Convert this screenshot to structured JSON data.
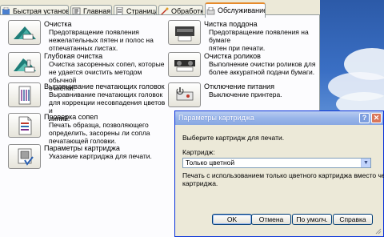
{
  "tabs": [
    {
      "label": "Быстрая установка",
      "icon": "quick-setup-icon"
    },
    {
      "label": "Главная",
      "icon": "main-icon"
    },
    {
      "label": "Страница",
      "icon": "page-icon"
    },
    {
      "label": "Обработка",
      "icon": "effects-icon"
    },
    {
      "label": "Обслуживание",
      "icon": "maintenance-icon",
      "active": true
    }
  ],
  "tasks_left": [
    {
      "title": "Очистка",
      "desc": [
        "Предотвращение появления",
        "нежелательных пятен и полос на",
        "отпечатанных листах."
      ],
      "icon": "cleaning-icon"
    },
    {
      "title": "Глубокая очистка",
      "desc": [
        "Очистка засоренных сопел, которые",
        "не удается очистить методом обычной",
        "очистки."
      ],
      "icon": "deep-cleaning-icon"
    },
    {
      "title": "Выравнивание печатающих головок",
      "desc": [
        "Выравнивание печатающих головок",
        "для коррекции несовпадения цветов и",
        "линий."
      ],
      "icon": "head-alignment-icon"
    },
    {
      "title": "Проверка сопел",
      "desc": [
        "Печать образца, позволяющего",
        "определить, засорены ли сопла",
        "печатающей головки."
      ],
      "icon": "nozzle-check-icon"
    },
    {
      "title": "Параметры картриджа",
      "desc": [
        "Указание картриджа для печати."
      ],
      "icon": "cartridge-settings-icon"
    }
  ],
  "tasks_right": [
    {
      "title": "Чистка поддона",
      "desc": [
        "Предотвращение появления на бумаге",
        "пятен при печати."
      ],
      "icon": "bottom-plate-cleaning-icon"
    },
    {
      "title": "Очистка роликов",
      "desc": [
        "Выполнение очистки роликов для",
        "более аккуратной подачи бумаги."
      ],
      "icon": "roller-cleaning-icon"
    },
    {
      "title": "Отключение питания",
      "desc": [
        "Выключение принтера."
      ],
      "icon": "power-off-icon"
    }
  ],
  "dialog": {
    "title": "Параметры картриджа",
    "help": "?",
    "close": "✕",
    "instruction": "Выберите картридж для печати.",
    "cartridge_label": "Картридж:",
    "cartridge_value": "Только цветной",
    "note": [
      "Печать с использованием только цветного картриджа вместо черного",
      "картриджа."
    ],
    "buttons": {
      "ok": "OK",
      "cancel": "Отмена",
      "defaults": "По умолч.",
      "help": "Справка"
    }
  }
}
